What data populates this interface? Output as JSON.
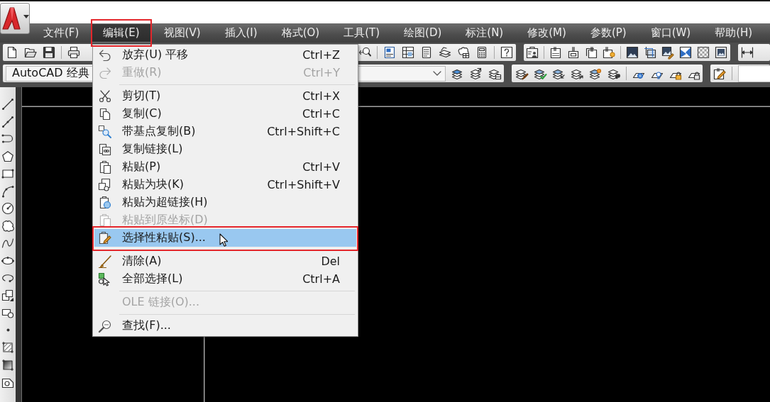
{
  "menu_bar": [
    {
      "label": "文件(F)",
      "selected": false
    },
    {
      "label": "编辑(E)",
      "selected": true
    },
    {
      "label": "视图(V)",
      "selected": false
    },
    {
      "label": "插入(I)",
      "selected": false
    },
    {
      "label": "格式(O)",
      "selected": false
    },
    {
      "label": "工具(T)",
      "selected": false
    },
    {
      "label": "绘图(D)",
      "selected": false
    },
    {
      "label": "标注(N)",
      "selected": false
    },
    {
      "label": "修改(M)",
      "selected": false
    },
    {
      "label": "参数(P)",
      "selected": false
    },
    {
      "label": "窗口(W)",
      "selected": false
    },
    {
      "label": "帮助(H)",
      "selected": false
    }
  ],
  "workspace_dropdown": {
    "value": "AutoCAD 经典"
  },
  "edit_menu": {
    "groups": [
      {
        "items": [
          {
            "label": "放弃(U) 平移",
            "shortcut": "Ctrl+Z",
            "disabled": false,
            "selected": false
          },
          {
            "label": "重做(R)",
            "shortcut": "Ctrl+Y",
            "disabled": true,
            "selected": false
          }
        ]
      },
      {
        "items": [
          {
            "label": "剪切(T)",
            "shortcut": "Ctrl+X",
            "disabled": false,
            "selected": false
          },
          {
            "label": "复制(C)",
            "shortcut": "Ctrl+C",
            "disabled": false,
            "selected": false
          },
          {
            "label": "带基点复制(B)",
            "shortcut": "Ctrl+Shift+C",
            "disabled": false,
            "selected": false
          },
          {
            "label": "复制链接(L)",
            "disabled": false,
            "selected": false
          },
          {
            "label": "粘贴(P)",
            "shortcut": "Ctrl+V",
            "disabled": false,
            "selected": false
          },
          {
            "label": "粘贴为块(K)",
            "shortcut": "Ctrl+Shift+V",
            "disabled": false,
            "selected": false
          },
          {
            "label": "粘贴为超链接(H)",
            "disabled": false,
            "selected": false
          },
          {
            "label": "粘贴到原坐标(D)",
            "disabled": true,
            "selected": false
          },
          {
            "label": "选择性粘贴(S)...",
            "disabled": false,
            "selected": true
          }
        ]
      },
      {
        "items": [
          {
            "label": "清除(A)",
            "shortcut": "Del",
            "disabled": false,
            "selected": false
          },
          {
            "label": "全部选择(L)",
            "shortcut": "Ctrl+A",
            "disabled": false,
            "selected": false
          }
        ]
      },
      {
        "items": [
          {
            "label": "OLE 链接(O)...",
            "disabled": true,
            "selected": false
          }
        ]
      },
      {
        "items": [
          {
            "label": "查找(F)...",
            "disabled": false,
            "selected": false
          }
        ]
      }
    ]
  }
}
